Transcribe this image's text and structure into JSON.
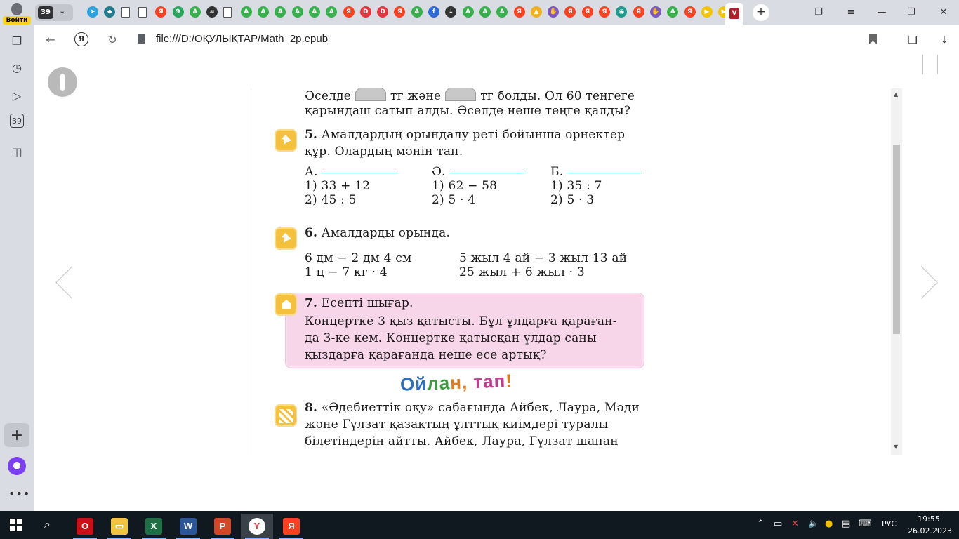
{
  "sidebar": {
    "login_label": "Войти",
    "tab_count_badge": "39",
    "more_label": "•••"
  },
  "tabstrip": {
    "tab_count": "39",
    "new_tab": "+",
    "favicons": [
      {
        "name": "telegram-icon",
        "color": "#2aa3df",
        "glyph": "➤"
      },
      {
        "name": "site-icon",
        "color": "#1f7a8c",
        "glyph": "◆"
      },
      {
        "name": "document-icon",
        "color": "#ffffff",
        "glyph": ""
      },
      {
        "name": "document-icon",
        "color": "#ffffff",
        "glyph": ""
      },
      {
        "name": "yandex-icon",
        "color": "#fc3f1d",
        "glyph": "Я"
      },
      {
        "name": "site-icon",
        "color": "#26a65b",
        "glyph": "9"
      },
      {
        "name": "site-icon",
        "color": "#35b34a",
        "glyph": "A"
      },
      {
        "name": "site-icon",
        "color": "#333333",
        "glyph": "≈"
      },
      {
        "name": "document-icon",
        "color": "#ffffff",
        "glyph": ""
      },
      {
        "name": "site-icon",
        "color": "#35b34a",
        "glyph": "A"
      },
      {
        "name": "site-icon",
        "color": "#35b34a",
        "glyph": "A"
      },
      {
        "name": "site-icon",
        "color": "#35b34a",
        "glyph": "A"
      },
      {
        "name": "site-icon",
        "color": "#35b34a",
        "glyph": "A"
      },
      {
        "name": "site-icon",
        "color": "#35b34a",
        "glyph": "A"
      },
      {
        "name": "site-icon",
        "color": "#35b34a",
        "glyph": "A"
      },
      {
        "name": "yandex-icon",
        "color": "#fc3f1d",
        "glyph": "Я"
      },
      {
        "name": "site-icon",
        "color": "#e8323c",
        "glyph": "D"
      },
      {
        "name": "site-icon",
        "color": "#e8323c",
        "glyph": "D"
      },
      {
        "name": "yandex-icon",
        "color": "#fc3f1d",
        "glyph": "Я"
      },
      {
        "name": "site-icon",
        "color": "#35b34a",
        "glyph": "A"
      },
      {
        "name": "site-icon",
        "color": "#2e6bd6",
        "glyph": "f"
      },
      {
        "name": "download-icon",
        "color": "#333333",
        "glyph": "↓"
      },
      {
        "name": "site-icon",
        "color": "#35b34a",
        "glyph": "A"
      },
      {
        "name": "site-icon",
        "color": "#35b34a",
        "glyph": "A"
      },
      {
        "name": "site-icon",
        "color": "#35b34a",
        "glyph": "A"
      },
      {
        "name": "yandex-icon",
        "color": "#fc3f1d",
        "glyph": "Я"
      },
      {
        "name": "image-icon",
        "color": "#f2b01e",
        "glyph": "▲"
      },
      {
        "name": "site-icon",
        "color": "#7e57c2",
        "glyph": "✋"
      },
      {
        "name": "yandex-icon",
        "color": "#fc3f1d",
        "glyph": "Я"
      },
      {
        "name": "yandex-icon",
        "color": "#fc3f1d",
        "glyph": "Я"
      },
      {
        "name": "yandex-icon",
        "color": "#fc3f1d",
        "glyph": "Я"
      },
      {
        "name": "site-icon",
        "color": "#1c9c8c",
        "glyph": "◉"
      },
      {
        "name": "yandex-icon",
        "color": "#fc3f1d",
        "glyph": "Я"
      },
      {
        "name": "site-icon",
        "color": "#7e57c2",
        "glyph": "✋"
      },
      {
        "name": "site-icon",
        "color": "#35b34a",
        "glyph": "A"
      },
      {
        "name": "yandex-icon",
        "color": "#fc3f1d",
        "glyph": "Я"
      },
      {
        "name": "play-icon",
        "color": "#f5c400",
        "glyph": "▶"
      },
      {
        "name": "play-icon",
        "color": "#f5c400",
        "glyph": "▶"
      }
    ],
    "active_favicon": "V"
  },
  "toolbar": {
    "url": "file:///D:/ОҚУЛЫҚТАР/Math_2p.epub",
    "yandex_glyph": "Я"
  },
  "page": {
    "intro_line1_a": "Әселде",
    "intro_line1_b": "тг және",
    "intro_line1_c": "тг болды. Ол 60 теңгеге",
    "intro_line2": "қарындаш сатып алды. Әселде неше теңге қалды?",
    "task5": {
      "num": "5.",
      "line1": "Амалдардың орындалу реті бойынша өрнектер",
      "line2": "құр. Олардың мәнін тап.",
      "columns": [
        {
          "head": "А.",
          "e1": "1) 33 + 12",
          "e2": "2) 45 : 5"
        },
        {
          "head": "Ә.",
          "e1": "1) 62 − 58",
          "e2": "2) 5 · 4"
        },
        {
          "head": "Б.",
          "e1": "1) 35 : 7",
          "e2": "2) 5 · 3"
        }
      ]
    },
    "task6": {
      "num": "6.",
      "title": "Амалдарды орында.",
      "left1": "6 дм − 2 дм 4 см",
      "left2": "1 ц − 7 кг · 4",
      "right1": "5 жыл 4 ай − 3 жыл 13 ай",
      "right2": "25 жыл + 6 жыл · 3"
    },
    "task7": {
      "num": "7.",
      "title": "Есепті шығар.",
      "line1": "Концертке 3 қыз қатысты. Бұл ұлдарға қараған-",
      "line2": "да 3-ке кем. Концертке қатысқан ұлдар саны",
      "line3": "қыздарға қарағанда неше есе артық?"
    },
    "think": {
      "p1": "Ой",
      "p2": "ла",
      "p3": "н, ",
      "p4": "тап",
      "p5": "!"
    },
    "task8": {
      "num": "8.",
      "line1": "«Әдебиеттік оқу» сабағында Айбек, Лаура, Мәди",
      "line2": "және Гүлзат қазақтың ұлттық киімдері туралы",
      "line3": "білетіндерін айтты. Айбек, Лаура, Гүлзат шапан"
    }
  },
  "taskbar": {
    "apps": [
      {
        "name": "opera-app",
        "color": "#cc0f16",
        "glyph": "O"
      },
      {
        "name": "file-explorer-app",
        "color": "#f0c43c",
        "glyph": "▭"
      },
      {
        "name": "excel-app",
        "color": "#1d7044",
        "glyph": "X"
      },
      {
        "name": "word-app",
        "color": "#2b579a",
        "glyph": "W"
      },
      {
        "name": "powerpoint-app",
        "color": "#d24726",
        "glyph": "P"
      },
      {
        "name": "yandex-browser-app",
        "color": "#ffffff",
        "glyph": "Y"
      },
      {
        "name": "yandex-app",
        "color": "#fc3f1d",
        "glyph": "Я"
      }
    ],
    "lang": "РУС",
    "time": "19:55",
    "date": "26.02.2023"
  }
}
